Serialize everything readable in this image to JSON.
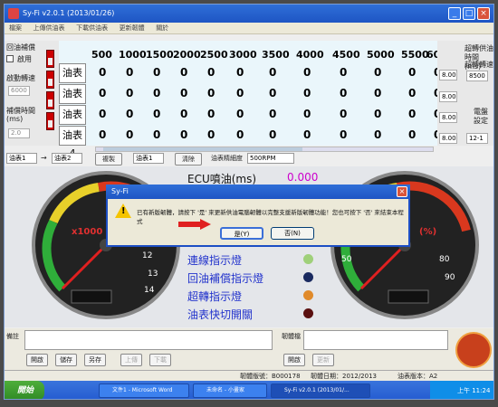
{
  "window": {
    "title": "Sy-Fi v2.0.1 (2013/01/26)",
    "controls": [
      "_",
      "□",
      "×"
    ]
  },
  "menu": [
    "檔案",
    "上傳供油表",
    "下載供油表",
    "更新韌體",
    "關於"
  ],
  "left_panel": {
    "comp_label": "回油補償",
    "enable_label": "啟用",
    "start_rpm_label": "啟動轉速",
    "start_rpm_value": "6000",
    "comp_time_label": "補償時間",
    "comp_time_unit": "(ms)",
    "comp_time_value": "2.0",
    "switch_on": "ON"
  },
  "grid": {
    "columns": [
      "500",
      "1000",
      "1500",
      "2000",
      "2500",
      "3000",
      "3500",
      "4000",
      "4500",
      "5000",
      "5500",
      "600"
    ],
    "rows": [
      {
        "label": "油表1",
        "values": [
          "0",
          "0",
          "0",
          "0",
          "0",
          "0",
          "0",
          "0",
          "0",
          "0",
          "0",
          "0"
        ]
      },
      {
        "label": "油表2",
        "values": [
          "0",
          "0",
          "0",
          "0",
          "0",
          "0",
          "0",
          "0",
          "0",
          "0",
          "0",
          "0"
        ]
      },
      {
        "label": "油表3",
        "values": [
          "0",
          "0",
          "0",
          "0",
          "0",
          "0",
          "0",
          "0",
          "0",
          "0",
          "0",
          "0"
        ]
      },
      {
        "label": "油表4",
        "values": [
          "0",
          "0",
          "0",
          "0",
          "0",
          "0",
          "0",
          "0",
          "0",
          "0",
          "0",
          "0"
        ]
      }
    ]
  },
  "right_panel": {
    "ultra_time_label": "超轉供油時間(ms)",
    "ultra_time_value": "8.00",
    "ultra_rpm_label": "超轉轉速",
    "ultra_rpm_value": "8500",
    "row_values": [
      "8.00",
      "8.00",
      "8.00",
      "8.00"
    ],
    "electric_label": "電盤設定",
    "electric_value": "12-1"
  },
  "toolbar": {
    "select1": "油表1",
    "arrow": "→",
    "select2": "油表2",
    "copy_label": "複製",
    "select3": "油表1",
    "clear_label": "清除",
    "precision_label": "油表精細度",
    "precision_value": "500RPM"
  },
  "dashboard": {
    "ecu_label": "ECU噴油(ms)",
    "ecu_value": "0.000",
    "rpm_label": "x1000 R",
    "afr_label": "(%)",
    "lamps": [
      {
        "label": "連線指示燈",
        "color": "#9fd07a"
      },
      {
        "label": "回油補償指示燈",
        "color": "#1a2a60"
      },
      {
        "label": "超轉指示燈",
        "color": "#e08a2a"
      },
      {
        "label": "油表快切開關",
        "color": "#5a1010"
      }
    ]
  },
  "bottom": {
    "memo1_label": "備註",
    "memo2_label": "韌體檔",
    "buttons_left": [
      "開啟",
      "儲存",
      "另存",
      "上傳",
      "下載"
    ],
    "buttons_right": [
      "開啟",
      "更新"
    ]
  },
  "status": {
    "firmware": "韌體版號：B000178",
    "date": "韌體日期：2012/2013",
    "tablever": "油表版本：A2"
  },
  "dialog": {
    "title": "Sy-Fi",
    "close": "×",
    "message": "已有新版韌體，請按下 '是' 來更新供油電腦韌體以完整支援新版韌體功能！您也可按下 '否' 來結束本程式",
    "yes_label": "是(Y)",
    "no_label": "否(N)",
    "warn_glyph": "!"
  },
  "taskbar": {
    "start_label": "開始",
    "tasks": [
      "文件1 - Microsoft Word",
      "未命名 - 小畫家",
      "Sy-Fi v2.0.1 (2013/01/..."
    ],
    "clock": "上午 11:24"
  }
}
